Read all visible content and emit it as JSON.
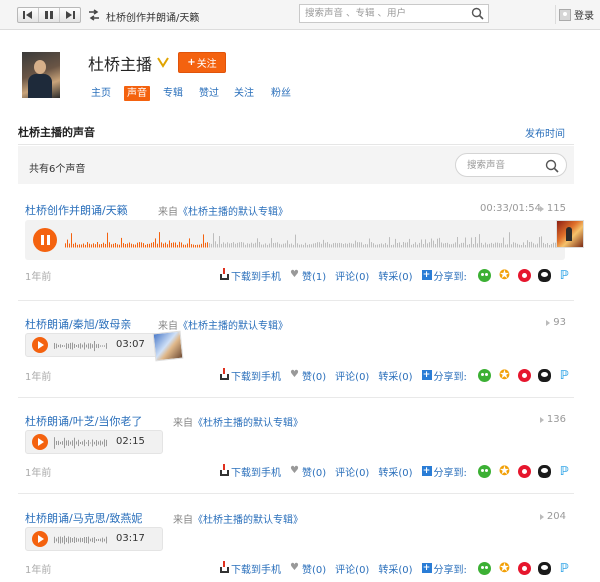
{
  "topbar": {
    "now_playing": "杜桥创作并朗诵/天籁",
    "search_placeholder": "搜索声音 、专辑 、用户",
    "login_label": "登录",
    "icons": [
      "prev-icon",
      "pause-icon",
      "next-icon",
      "shuffle-icon",
      "search-icon",
      "user-icon"
    ]
  },
  "profile": {
    "name": "杜桥主播",
    "follow_label": "关注",
    "follow_plus": "+",
    "tabs": [
      "主页",
      "声音",
      "专辑",
      "赞过",
      "关注",
      "粉丝"
    ],
    "active_tab": "声音"
  },
  "section": {
    "title": "杜桥主播的声音",
    "sort_label": "发布时间",
    "count_text": "共有6个声音",
    "search_placeholder": "搜索声音"
  },
  "actions": {
    "download": "下载到手机",
    "share": "分享到:"
  },
  "tracks": [
    {
      "title": "杜桥创作并朗诵/天籁",
      "from_prefix": "来自",
      "album": "《杜桥主播的默认专辑》",
      "elapsed_total": "00:33/01:54",
      "plays": "115",
      "ago": "1年前",
      "like": "赞(1)",
      "comment": "评论(0)",
      "repost": "转采(0)",
      "playing": true,
      "progress": 0.29
    },
    {
      "title": "杜桥朗诵/秦旭/致母亲",
      "from_prefix": "来自",
      "album": "《杜桥主播的默认专辑》",
      "duration": "03:07",
      "plays": "93",
      "ago": "1年前",
      "like": "赞(0)",
      "comment": "评论(0)",
      "repost": "转采(0)",
      "playing": false
    },
    {
      "title": "杜桥朗诵/叶芝/当你老了",
      "from_prefix": "来自",
      "album": "《杜桥主播的默认专辑》",
      "duration": "02:15",
      "plays": "136",
      "ago": "1年前",
      "like": "赞(0)",
      "comment": "评论(0)",
      "repost": "转采(0)",
      "playing": false
    },
    {
      "title": "杜桥朗诵/马克思/致燕妮",
      "from_prefix": "来自",
      "album": "《杜桥主播的默认专辑》",
      "duration": "03:17",
      "plays": "204",
      "ago": "1年前",
      "like": "赞(0)",
      "comment": "评论(0)",
      "repost": "转采(0)",
      "playing": false
    }
  ],
  "colors": {
    "accent": "#f4620f",
    "link": "#2a6fbb",
    "wave_played": "#f4620f",
    "wave_rest": "#bdbdbd"
  }
}
